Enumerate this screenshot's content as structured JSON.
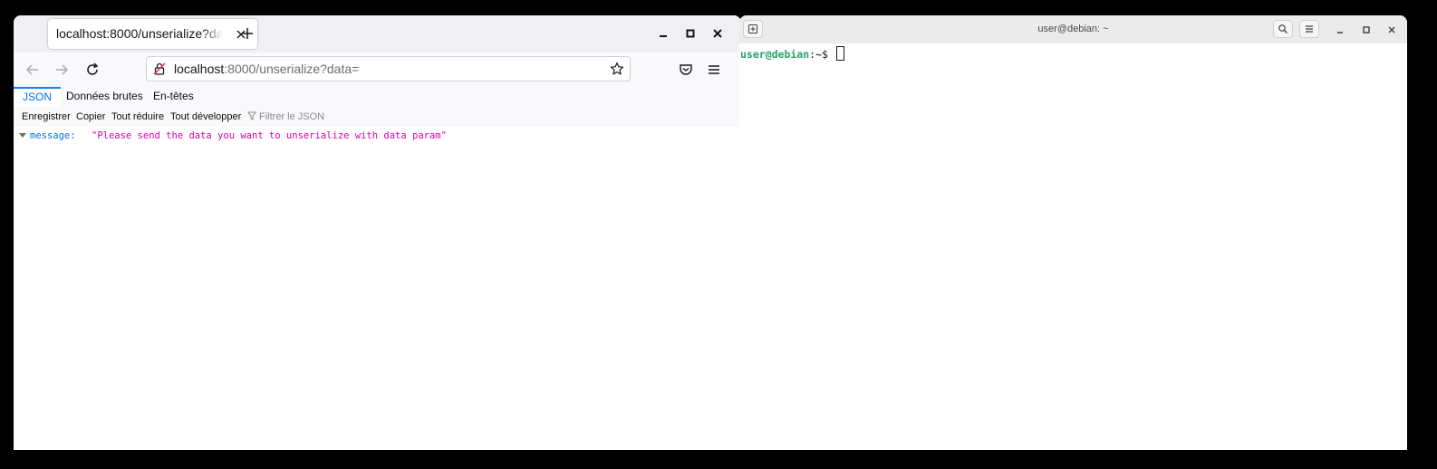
{
  "browser": {
    "tab_title": "localhost:8000/unserialize?data=",
    "url_host": "localhost",
    "url_rest": ":8000/unserialize?data=",
    "json_tabs": [
      "JSON",
      "Données brutes",
      "En-têtes"
    ],
    "toolbar": {
      "save": "Enregistrer",
      "copy": "Copier",
      "collapse_all": "Tout réduire",
      "expand_all": "Tout développer",
      "filter_placeholder": "Filtrer le JSON"
    },
    "json": {
      "key": "message:",
      "value": "\"Please send the data you want to unserialize with data param\""
    }
  },
  "terminal": {
    "title": "user@debian: ~",
    "prompt_user": "user@debian",
    "prompt_sep": ":",
    "prompt_path": "~",
    "prompt_symbol": "$ "
  }
}
